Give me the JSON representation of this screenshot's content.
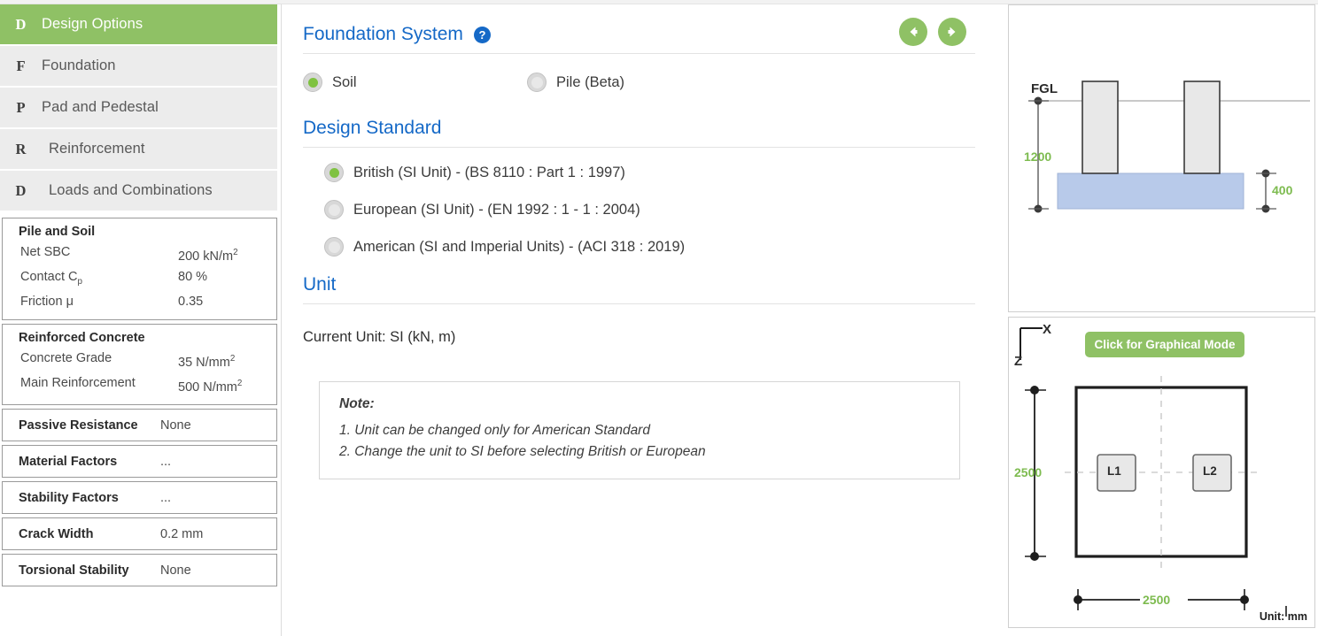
{
  "sidebar": {
    "nav_items": [
      {
        "badge": "D",
        "label": "Design Options",
        "active": true
      },
      {
        "badge": "F",
        "label": "Foundation",
        "active": false
      },
      {
        "badge": "P",
        "label": "Pad and Pedestal",
        "active": false
      },
      {
        "badge": "R",
        "label": "Reinforcement",
        "active": false
      },
      {
        "badge": "D",
        "label": "Loads and Combinations",
        "active": false
      }
    ],
    "cards": [
      {
        "title": "Pile and Soil",
        "rows": [
          {
            "key": "Net SBC",
            "value": "200 kN/m",
            "sup": "2"
          },
          {
            "key": "Contact C",
            "sub": "p",
            "value": "80 %"
          },
          {
            "key": "Friction μ",
            "value": "0.35"
          }
        ]
      },
      {
        "title": "Reinforced Concrete",
        "rows": [
          {
            "key": "Concrete Grade",
            "value": "35 N/mm",
            "sup": "2"
          },
          {
            "key": "Main Reinforcement",
            "value": "500 N/mm",
            "sup": "2"
          }
        ]
      }
    ],
    "single_cards": [
      {
        "key": "Passive Resistance",
        "value": "None"
      },
      {
        "key": "Material Factors",
        "value": "..."
      },
      {
        "key": "Stability Factors",
        "value": "..."
      },
      {
        "key": "Crack Width",
        "value": "0.2 mm"
      },
      {
        "key": "Torsional Stability",
        "value": "None"
      }
    ]
  },
  "main": {
    "foundation_system": {
      "title": "Foundation System",
      "help_glyph": "?",
      "options": [
        {
          "label": "Soil",
          "selected": true
        },
        {
          "label": "Pile (Beta)",
          "selected": false
        }
      ]
    },
    "design_standard": {
      "title": "Design Standard",
      "options": [
        {
          "label": "British (SI Unit) - (BS 8110 : Part 1 : 1997)",
          "selected": true
        },
        {
          "label": "European (SI Unit) - (EN 1992 : 1 - 1 : 2004)",
          "selected": false
        },
        {
          "label": "American (SI and Imperial Units) - (ACI 318 : 2019)",
          "selected": false
        }
      ]
    },
    "unit": {
      "title": "Unit",
      "current": "Current Unit: SI (kN, m)",
      "note_heading": "Note:",
      "note_lines": [
        "1. Unit can be changed only for American Standard",
        "2. Change the unit to SI before selecting British or European"
      ]
    }
  },
  "diagrams": {
    "elevation": {
      "fgl_label": "FGL",
      "depth": "1200",
      "thickness": "400"
    },
    "plan": {
      "axis_x": "X",
      "axis_z": "Z",
      "graphical_mode_button": "Click for Graphical Mode",
      "height_dim": "2500",
      "width_dim": "2500",
      "columns": [
        "L1",
        "L2"
      ],
      "unit_tag": "Unit: mm"
    }
  },
  "colors": {
    "accent_green": "#8fc165",
    "radio_green": "#7fc241",
    "heading_blue": "#1569c7",
    "dim_green": "#7dbb4f",
    "pad_blue": "#b8caea"
  }
}
